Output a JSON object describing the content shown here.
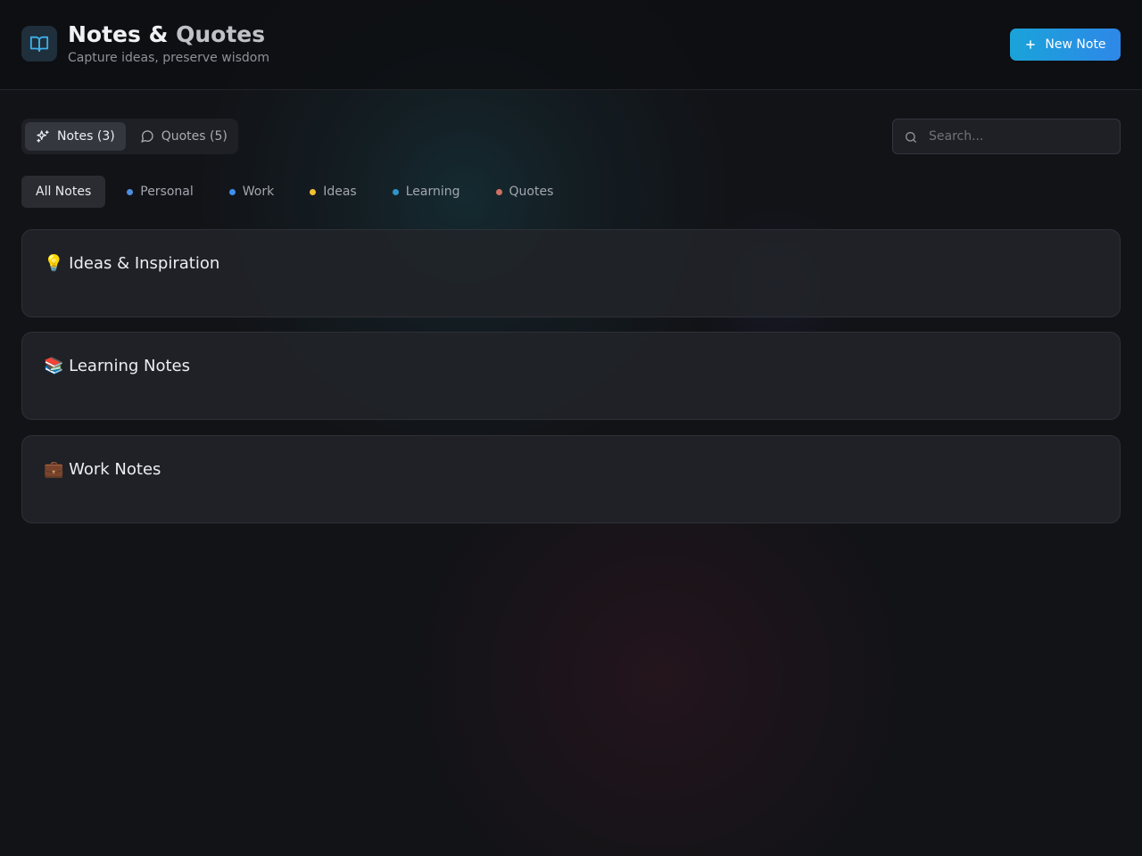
{
  "app": {
    "title_main": "Notes & ",
    "title_accent": "Quotes",
    "subtitle": "Capture ideas, preserve wisdom",
    "new_note_label": "New Note"
  },
  "tabs": [
    {
      "label": "Notes (3)",
      "icon": "sparkles-icon",
      "active": true
    },
    {
      "label": "Quotes (5)",
      "icon": "message-circle-icon",
      "active": false
    }
  ],
  "search": {
    "placeholder": "Search...",
    "value": ""
  },
  "filters": [
    {
      "label": "All Notes",
      "active": true
    },
    {
      "label": "Personal",
      "color": "#4a8fe0"
    },
    {
      "label": "Work",
      "color": "#3d8ff0"
    },
    {
      "label": "Ideas",
      "color": "#f0c030"
    },
    {
      "label": "Learning",
      "color": "#2e96c8"
    },
    {
      "label": "Quotes",
      "color": "#d07060"
    }
  ],
  "sections": [
    {
      "title": "💡 Ideas & Inspiration"
    },
    {
      "title": "📚 Learning Notes"
    },
    {
      "title": "💼 Work Notes"
    }
  ],
  "colors": {
    "accent_start": "#1aa3d9",
    "accent_end": "#2e88e8",
    "background": "#121317"
  }
}
